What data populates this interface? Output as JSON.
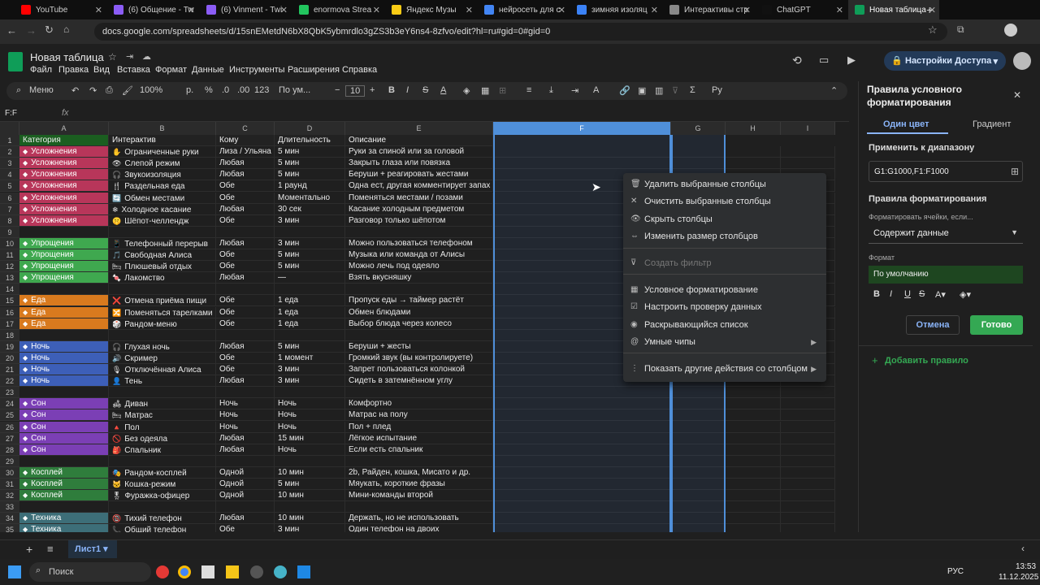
{
  "tabs": [
    {
      "label": "YouTube",
      "color": "#ff0000"
    },
    {
      "label": "(6) Общение - Tw",
      "color": "#8b5cf6"
    },
    {
      "label": "(6) Vinment - Twi",
      "color": "#8b5cf6"
    },
    {
      "label": "enormova Strea",
      "color": "#22c55e"
    },
    {
      "label": "Яндекс Музы",
      "color": "#facc15"
    },
    {
      "label": "нейросеть для с",
      "color": "#4285f4"
    },
    {
      "label": "зимняя изоляц",
      "color": "#3b82f6"
    },
    {
      "label": "Интерактивы стр",
      "color": "#888888"
    },
    {
      "label": "ChatGPT",
      "color": "#111111"
    },
    {
      "label": "Новая таблица -",
      "color": "#0f9d58"
    }
  ],
  "url": "docs.google.com/spreadsheets/d/15snEMetdN6bX8QbK5ybmrdlo3gZS3b3eY6ns4-8zfvo/edit?hl=ru#gid=0#gid=0",
  "doc": {
    "title": "Новая таблица",
    "share": "Настройки Доступа"
  },
  "menus": [
    "Файл",
    "Правка",
    "Вид",
    "Вставка",
    "Формат",
    "Данные",
    "Инструменты",
    "Расширения",
    "Справка"
  ],
  "toolbar": {
    "search": "Меню",
    "zoom": "100%",
    "currency": "р.",
    "percent": "%",
    "dec1": ".0",
    "dec2": ".00",
    "num": "123",
    "font": "По ум...",
    "size": "10"
  },
  "namebox": "F:F",
  "columns": [
    {
      "label": "",
      "w": 24
    },
    {
      "label": "A",
      "w": 110
    },
    {
      "label": "B",
      "w": 132
    },
    {
      "label": "C",
      "w": 72
    },
    {
      "label": "D",
      "w": 87
    },
    {
      "label": "E",
      "w": 182
    },
    {
      "label": "F",
      "w": 219
    },
    {
      "label": "G",
      "w": 67
    },
    {
      "label": "H",
      "w": 68
    },
    {
      "label": "I",
      "w": 67
    }
  ],
  "header_row": {
    "num": "1",
    "cells": [
      "Категория",
      "Интерактив",
      "Кому",
      "Длительность",
      "Описание"
    ]
  },
  "rows": [
    {
      "num": "2",
      "cat": "Усложнения",
      "color": "#b8365a",
      "icon": "✋",
      "b": "Ограниченные руки",
      "c": "Лиза / Ульяна",
      "d": "5 мин",
      "e": "Руки за спиной или за головой"
    },
    {
      "num": "3",
      "cat": "Усложнения",
      "color": "#b8365a",
      "icon": "👁",
      "b": "Слепой режим",
      "c": "Любая",
      "d": "5 мин",
      "e": "Закрыть глаза или повязка"
    },
    {
      "num": "4",
      "cat": "Усложнения",
      "color": "#b8365a",
      "icon": "🎧",
      "b": "Звукоизоляция",
      "c": "Любая",
      "d": "5 мин",
      "e": "Беруши + реагировать жестами"
    },
    {
      "num": "5",
      "cat": "Усложнения",
      "color": "#b8365a",
      "icon": "🍴",
      "b": "Раздельная еда",
      "c": "Обе",
      "d": "1 раунд",
      "e": "Одна ест, другая комментирует запах"
    },
    {
      "num": "6",
      "cat": "Усложнения",
      "color": "#b8365a",
      "icon": "🔄",
      "b": "Обмен местами",
      "c": "Обе",
      "d": "Моментально",
      "e": "Поменяться местами / позами"
    },
    {
      "num": "7",
      "cat": "Усложнения",
      "color": "#b8365a",
      "icon": "❄",
      "b": "Холодное касание",
      "c": "Любая",
      "d": "30 сек",
      "e": "Касание холодным предметом"
    },
    {
      "num": "8",
      "cat": "Усложнения",
      "color": "#b8365a",
      "icon": "🤫",
      "b": "Шёпот-челлендж",
      "c": "Обе",
      "d": "3 мин",
      "e": "Разговор только шёпотом"
    },
    {
      "num": "9",
      "cat": "",
      "color": "",
      "icon": "",
      "b": "",
      "c": "",
      "d": "",
      "e": ""
    },
    {
      "num": "10",
      "cat": "Упрощения",
      "color": "#3fa84f",
      "icon": "📱",
      "b": "Телефонный перерыв",
      "c": "Любая",
      "d": "3 мин",
      "e": "Можно пользоваться телефоном"
    },
    {
      "num": "11",
      "cat": "Упрощения",
      "color": "#3fa84f",
      "icon": "🎵",
      "b": "Свободная Алиса",
      "c": "Обе",
      "d": "5 мин",
      "e": "Музыка или команда от Алисы"
    },
    {
      "num": "12",
      "cat": "Упрощения",
      "color": "#3fa84f",
      "icon": "🛏",
      "b": "Плюшевый отдых",
      "c": "Обе",
      "d": "5 мин",
      "e": "Можно лечь под одеяло"
    },
    {
      "num": "13",
      "cat": "Упрощения",
      "color": "#3fa84f",
      "icon": "🍬",
      "b": "Лакомство",
      "c": "Любая",
      "d": "—",
      "e": "Взять вкусняшку"
    },
    {
      "num": "14",
      "cat": "",
      "color": "",
      "icon": "",
      "b": "",
      "c": "",
      "d": "",
      "e": ""
    },
    {
      "num": "15",
      "cat": "Еда",
      "color": "#d97a1e",
      "icon": "❌",
      "b": "Отмена приёма пищи",
      "c": "Обе",
      "d": "1 еда",
      "e": "Пропуск еды → таймер растёт"
    },
    {
      "num": "16",
      "cat": "Еда",
      "color": "#d97a1e",
      "icon": "🔀",
      "b": "Поменяться тарелками",
      "c": "Обе",
      "d": "1 еда",
      "e": "Обмен блюдами"
    },
    {
      "num": "17",
      "cat": "Еда",
      "color": "#d97a1e",
      "icon": "🎲",
      "b": "Рандом-меню",
      "c": "Обе",
      "d": "1 еда",
      "e": "Выбор блюда через колесо"
    },
    {
      "num": "18",
      "cat": "",
      "color": "",
      "icon": "",
      "b": "",
      "c": "",
      "d": "",
      "e": ""
    },
    {
      "num": "19",
      "cat": "Ночь",
      "color": "#3d5fb8",
      "icon": "🎧",
      "b": "Глухая ночь",
      "c": "Любая",
      "d": "5 мин",
      "e": "Беруши + жесты"
    },
    {
      "num": "20",
      "cat": "Ночь",
      "color": "#3d5fb8",
      "icon": "🔊",
      "b": "Скример",
      "c": "Обе",
      "d": "1 момент",
      "e": "Громкий звук (вы контролируете)"
    },
    {
      "num": "21",
      "cat": "Ночь",
      "color": "#3d5fb8",
      "icon": "🎙",
      "b": "Отключённая Алиса",
      "c": "Обе",
      "d": "3 мин",
      "e": "Запрет пользоваться колонкой"
    },
    {
      "num": "22",
      "cat": "Ночь",
      "color": "#3d5fb8",
      "icon": "👤",
      "b": "Тень",
      "c": "Любая",
      "d": "3 мин",
      "e": "Сидеть в затемнённом углу"
    },
    {
      "num": "23",
      "cat": "",
      "color": "",
      "icon": "",
      "b": "",
      "c": "",
      "d": "",
      "e": ""
    },
    {
      "num": "24",
      "cat": "Сон",
      "color": "#7b3fb5",
      "icon": "🛋",
      "b": "Диван",
      "c": "Ночь",
      "d": "Ночь",
      "e": "Комфортно"
    },
    {
      "num": "25",
      "cat": "Сон",
      "color": "#7b3fb5",
      "icon": "🛏",
      "b": "Матрас",
      "c": "Ночь",
      "d": "Ночь",
      "e": "Матрас на полу"
    },
    {
      "num": "26",
      "cat": "Сон",
      "color": "#7b3fb5",
      "icon": "🔺",
      "b": "Пол",
      "c": "Ночь",
      "d": "Ночь",
      "e": "Пол + плед"
    },
    {
      "num": "27",
      "cat": "Сон",
      "color": "#7b3fb5",
      "icon": "🚫",
      "b": "Без одеяла",
      "c": "Любая",
      "d": "15 мин",
      "e": "Лёгкое испытание"
    },
    {
      "num": "28",
      "cat": "Сон",
      "color": "#7b3fb5",
      "icon": "🎒",
      "b": "Спальник",
      "c": "Любая",
      "d": "Ночь",
      "e": "Если есть спальник"
    },
    {
      "num": "29",
      "cat": "",
      "color": "",
      "icon": "",
      "b": "",
      "c": "",
      "d": "",
      "e": ""
    },
    {
      "num": "30",
      "cat": "Косплей",
      "color": "#2f7d3c",
      "icon": "🎭",
      "b": "Рандом-косплей",
      "c": "Одной",
      "d": "10 мин",
      "e": "2b, Райден, кошка, Мисато и др."
    },
    {
      "num": "31",
      "cat": "Косплей",
      "color": "#2f7d3c",
      "icon": "🐱",
      "b": "Кошка-режим",
      "c": "Одной",
      "d": "5 мин",
      "e": "Мяукать, короткие фразы"
    },
    {
      "num": "32",
      "cat": "Косплей",
      "color": "#2f7d3c",
      "icon": "🎖",
      "b": "Фуражка-офицер",
      "c": "Одной",
      "d": "10 мин",
      "e": "Мини-команды второй"
    },
    {
      "num": "33",
      "cat": "",
      "color": "",
      "icon": "",
      "b": "",
      "c": "",
      "d": "",
      "e": ""
    },
    {
      "num": "34",
      "cat": "Техника",
      "color": "#3d6e78",
      "icon": "📵",
      "b": "Тихий телефон",
      "c": "Любая",
      "d": "10 мин",
      "e": "Держать, но не использовать"
    },
    {
      "num": "35",
      "cat": "Техника",
      "color": "#3d6e78",
      "icon": "📞",
      "b": "Общий телефон",
      "c": "Обе",
      "d": "3 мин",
      "e": "Один телефон на двоих"
    }
  ],
  "context_menu": [
    {
      "icon": "🗑",
      "label": "Удалить выбранные столбцы",
      "disabled": false,
      "sub": false
    },
    {
      "icon": "✕",
      "label": "Очистить выбранные столбцы",
      "disabled": false,
      "sub": false
    },
    {
      "icon": "👁",
      "label": "Скрыть столбцы",
      "disabled": false,
      "sub": false
    },
    {
      "icon": "⇔",
      "label": "Изменить размер столбцов",
      "disabled": false,
      "sub": false
    },
    {
      "icon": "⊽",
      "label": "Создать фильтр",
      "disabled": true,
      "sub": false
    },
    {
      "icon": "▦",
      "label": "Условное форматирование",
      "disabled": false,
      "sub": false
    },
    {
      "icon": "☑",
      "label": "Настроить проверку данных",
      "disabled": false,
      "sub": false
    },
    {
      "icon": "◉",
      "label": "Раскрывающийся список",
      "disabled": false,
      "sub": false
    },
    {
      "icon": "@",
      "label": "Умные чипы",
      "disabled": false,
      "sub": true
    },
    {
      "icon": "⋮",
      "label": "Показать другие действия со столбцом",
      "disabled": false,
      "sub": true
    }
  ],
  "panel": {
    "title": "Правила условного форматирования",
    "tab1": "Один цвет",
    "tab2": "Градиент",
    "range_label": "Применить к диапазону",
    "range_value": "G1:G1000,F1:F1000",
    "rules_label": "Правила форматирования",
    "cond_label": "Форматировать ячейки, если...",
    "cond_value": "Содержит данные",
    "format_label": "Формат",
    "preview": "По умолчанию",
    "cancel": "Отмена",
    "done": "Готово",
    "add": "Добавить правило"
  },
  "sheet": {
    "name": "Лист1"
  },
  "taskbar": {
    "search": "Поиск",
    "lang": "РУС",
    "time": "13:53",
    "date": "11.12.2025"
  }
}
